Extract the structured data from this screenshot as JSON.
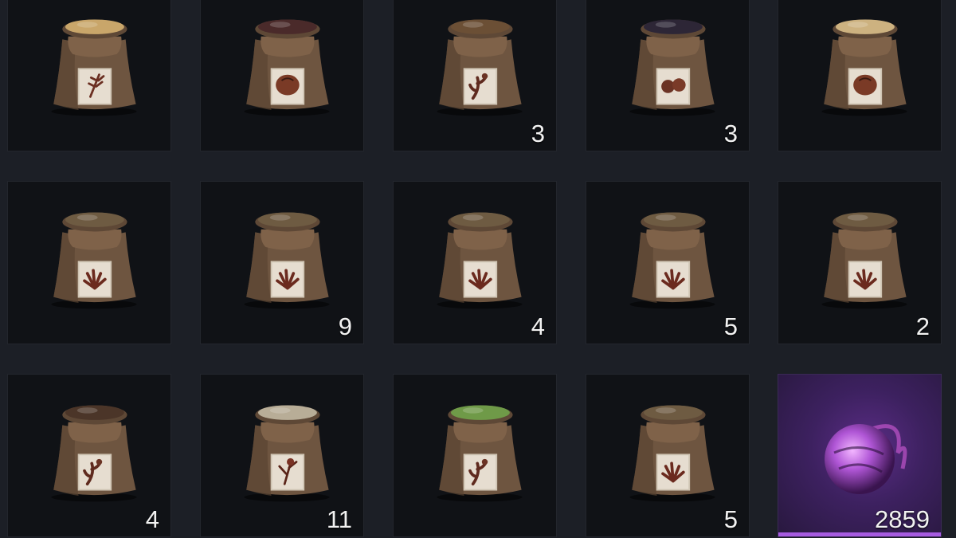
{
  "inventory": {
    "slots": [
      {
        "item": "grain-seed-bag",
        "seed_color": "#c9a66a",
        "emblem": "wheat",
        "count": ""
      },
      {
        "item": "bean-seed-bag",
        "seed_color": "#4a2a2a",
        "emblem": "round-fruit",
        "count": ""
      },
      {
        "item": "mixed-seed-bag",
        "seed_color": "#6b4f35",
        "emblem": "root",
        "count": "3"
      },
      {
        "item": "dark-seed-bag",
        "seed_color": "#2d2636",
        "emblem": "berries",
        "count": "3"
      },
      {
        "item": "grain-seed-bag",
        "seed_color": "#cdb280",
        "emblem": "round-fruit",
        "count": ""
      },
      {
        "item": "herb-seed-bag",
        "seed_color": "#6e5b42",
        "emblem": "sprout",
        "count": ""
      },
      {
        "item": "herb-seed-bag",
        "seed_color": "#6e5b42",
        "emblem": "sprout",
        "count": "9"
      },
      {
        "item": "herb-seed-bag",
        "seed_color": "#6e5b42",
        "emblem": "sprout",
        "count": "4"
      },
      {
        "item": "herb-seed-bag",
        "seed_color": "#6e5b42",
        "emblem": "sprout",
        "count": "5"
      },
      {
        "item": "herb-seed-bag",
        "seed_color": "#6e5b42",
        "emblem": "sprout",
        "count": "2"
      },
      {
        "item": "root-seed-bag",
        "seed_color": "#4b3528",
        "emblem": "root",
        "count": "4"
      },
      {
        "item": "pale-seed-bag",
        "seed_color": "#b8ad97",
        "emblem": "flower",
        "count": "11"
      },
      {
        "item": "pea-seed-bag",
        "seed_color": "#6f9a48",
        "emblem": "root",
        "count": ""
      },
      {
        "item": "herb-seed-bag",
        "seed_color": "#6e5b42",
        "emblem": "sprout",
        "count": "5"
      },
      {
        "item": "purple-orb",
        "seed_color": "#b056d6",
        "emblem": "orb",
        "count": "2859"
      }
    ]
  }
}
